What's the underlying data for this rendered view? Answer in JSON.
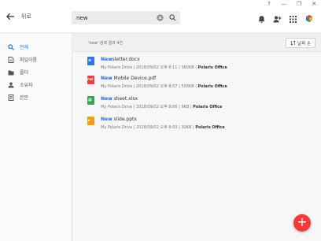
{
  "window": {
    "help": "?",
    "minimize": "—",
    "restore": "❐",
    "close": "✕"
  },
  "header": {
    "back_label": "뒤로"
  },
  "search": {
    "value": "new",
    "placeholder": ""
  },
  "sidebar": {
    "items": [
      {
        "label": "전체",
        "icon": "search-icon",
        "active": true
      },
      {
        "label": "파일이름",
        "icon": "file-name-icon",
        "active": false
      },
      {
        "label": "폴더",
        "icon": "folder-icon",
        "active": false
      },
      {
        "label": "소유자",
        "icon": "owner-icon",
        "active": false
      },
      {
        "label": "본문",
        "icon": "document-icon",
        "active": false
      }
    ]
  },
  "results": {
    "summary": "'new' 검색 결과 4건",
    "sort_label": "날짜 순"
  },
  "files": [
    {
      "highlight": "New",
      "rest": "sletter.docx",
      "type": "docx",
      "icon_color": "#2b78e4",
      "icon_letter": "≡",
      "location": "My Polaris Drive",
      "date": "2018/09/02 오후 8:11",
      "size": "360KB",
      "owner": "Polaris Office"
    },
    {
      "highlight": "New",
      "rest": " Mobile Device.pdf",
      "type": "pdf",
      "icon_color": "#e34343",
      "icon_letter": "PDF",
      "location": "My Polaris Drive",
      "date": "2018/09/02 오후 8:07",
      "size": "558KB",
      "owner": "Polaris Office"
    },
    {
      "highlight": "New",
      "rest": " sheet.xlsx",
      "type": "xlsx",
      "icon_color": "#2fa84f",
      "icon_letter": "▦",
      "location": "My Polaris Drive",
      "date": "2018/09/02 오후 8:06",
      "size": "9KB",
      "owner": "Polaris Office"
    },
    {
      "highlight": "New",
      "rest": " slide.pptx",
      "type": "pptx",
      "icon_color": "#f39a1e",
      "icon_letter": "▸",
      "location": "My Polaris Drive",
      "date": "2018/09/02 오후 8:03",
      "size": "30KB",
      "owner": "Polaris Office"
    }
  ],
  "fab": {
    "label": "+"
  },
  "colors": {
    "accent": "#1e6fd9",
    "fab": "#f03b3b"
  }
}
